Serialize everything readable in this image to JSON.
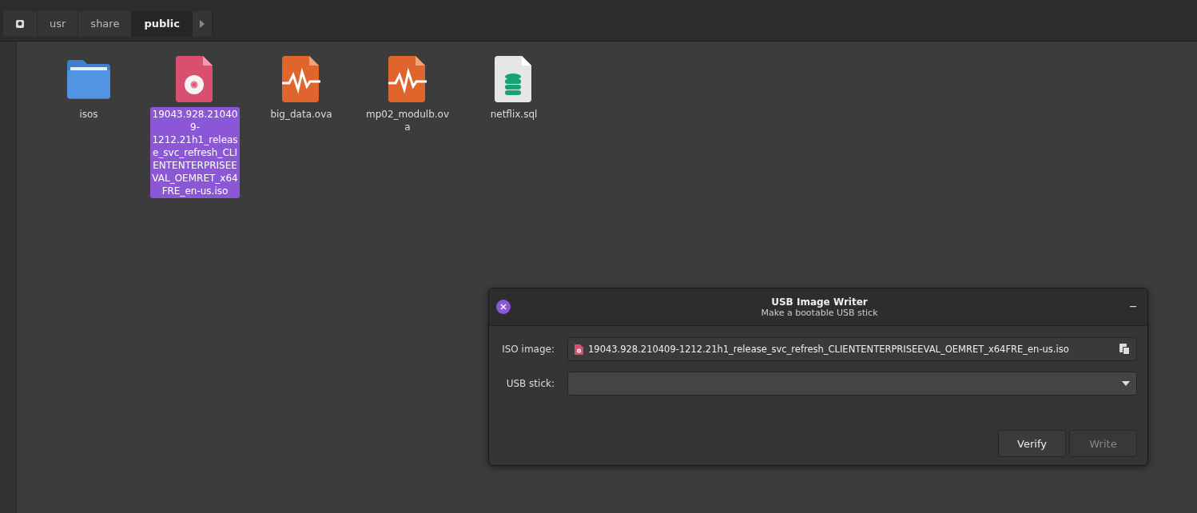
{
  "breadcrumb": [
    {
      "kind": "home",
      "selected": false
    },
    {
      "kind": "dir",
      "label": "usr",
      "selected": false
    },
    {
      "kind": "dir",
      "label": "share",
      "selected": false
    },
    {
      "kind": "dir",
      "label": "public",
      "selected": true
    }
  ],
  "files": [
    {
      "kind": "folder",
      "name": "isos",
      "selected": false
    },
    {
      "kind": "iso",
      "name": "19043.928.210409-1212.21h1_release_svc_refresh_CLIENTENTERPRISEEVAL_OEMRET_x64FRE_en-us.iso",
      "selected": true
    },
    {
      "kind": "ova",
      "name": "big_data.ova",
      "selected": false
    },
    {
      "kind": "ova",
      "name": "mp02_modulb.ova",
      "selected": false
    },
    {
      "kind": "sql",
      "name": "netflix.sql",
      "selected": false
    }
  ],
  "dialog": {
    "title": "USB Image Writer",
    "subtitle": "Make a bootable USB stick",
    "iso_label": "ISO image:",
    "iso_value": "19043.928.210409-1212.21h1_release_svc_refresh_CLIENTENTERPRISEEVAL_OEMRET_x64FRE_en-us.iso",
    "usb_label": "USB stick:",
    "buttons": [
      {
        "label": "Verify",
        "disabled": false
      },
      {
        "label": "Write",
        "disabled": true
      }
    ]
  }
}
